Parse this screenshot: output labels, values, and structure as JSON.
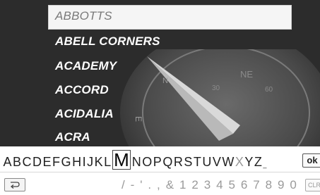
{
  "list": {
    "entries": [
      "ABBOTTS",
      "ABELL CORNERS",
      "ACADEMY",
      "ACCORD",
      "ACIDALIA",
      "ACRA"
    ],
    "selected_index": 0
  },
  "compass": {
    "north_label": "N",
    "northeast_label": "NE",
    "east_label": "E",
    "tick_30": "30",
    "tick_60": "60"
  },
  "keyboard": {
    "letters_left": [
      "A",
      "B",
      "C",
      "D",
      "E",
      "F",
      "G",
      "H",
      "I",
      "J",
      "K",
      "L"
    ],
    "active_letter": "M",
    "letters_right": [
      "N",
      "O",
      "P",
      "Q",
      "R",
      "S",
      "T",
      "U",
      "V",
      "W"
    ],
    "dim_letter": "X",
    "letters_tail": [
      "Y",
      "Z"
    ],
    "small_char": "_",
    "ok_label": "ok"
  },
  "bottom_bar": {
    "symbols": "/ - ' . , & 1 2 3 4 5 6 7 8 9 0",
    "clr_label": "CLR",
    "back_icon": "back-arrow-icon"
  }
}
